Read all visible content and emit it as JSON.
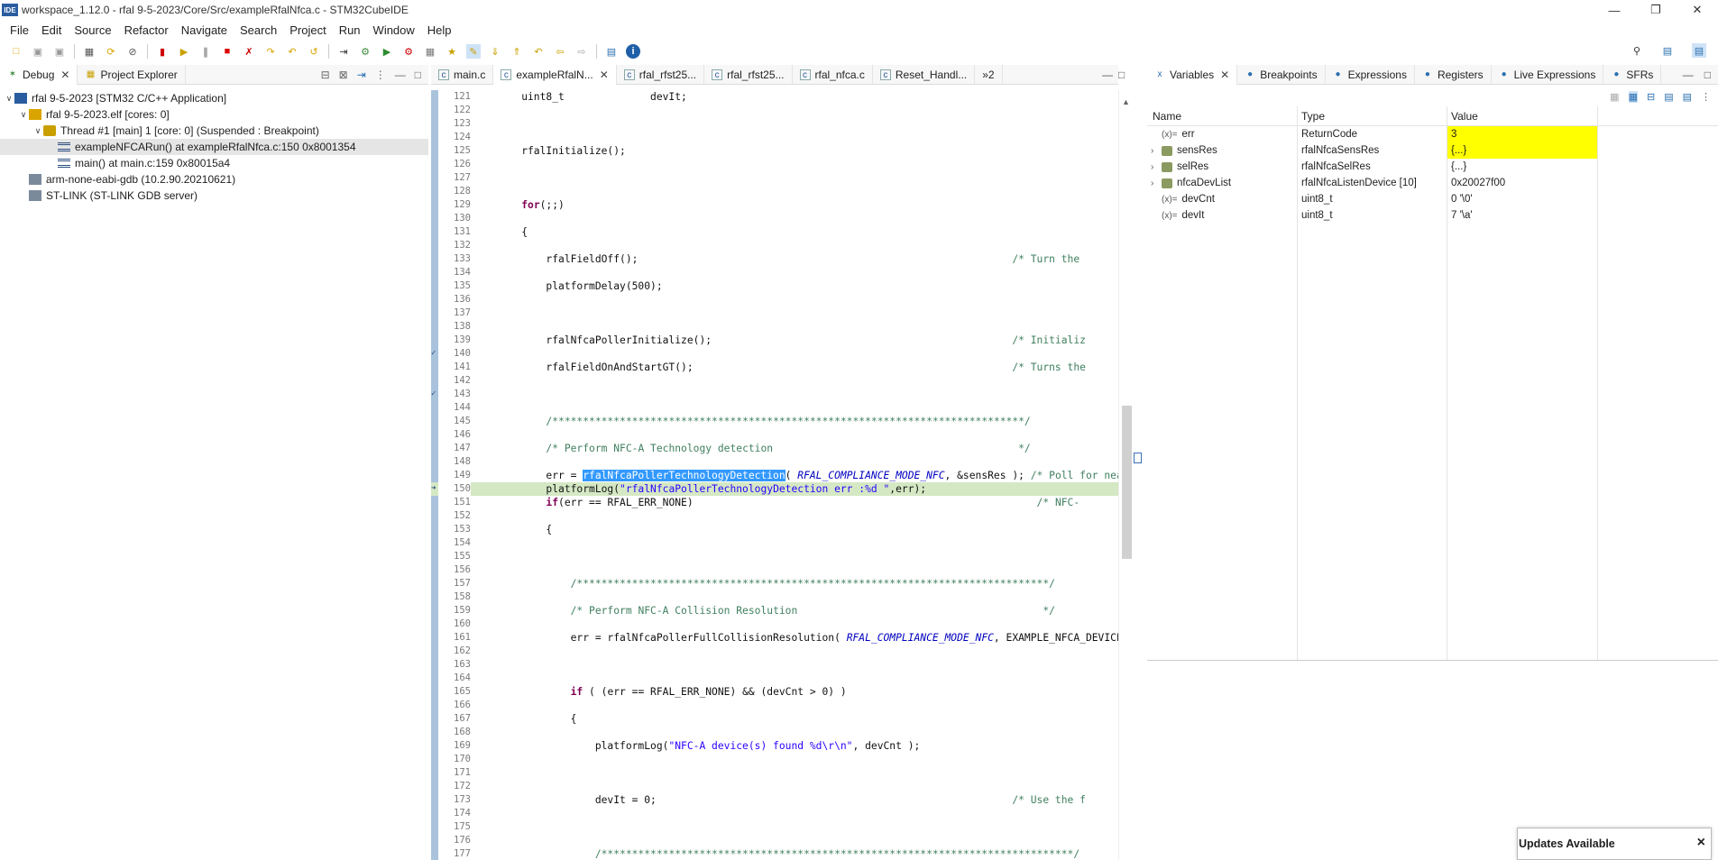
{
  "window": {
    "title": "workspace_1.12.0 - rfal 9-5-2023/Core/Src/exampleRfalNfca.c - STM32CubeIDE",
    "app_badge": "IDE"
  },
  "menu": [
    "File",
    "Edit",
    "Source",
    "Refactor",
    "Navigate",
    "Search",
    "Project",
    "Run",
    "Window",
    "Help"
  ],
  "left_tabs": {
    "debug": "Debug",
    "project_explorer": "Project Explorer"
  },
  "debug_tree": [
    {
      "label": "rfal 9-5-2023 [STM32 C/C++ Application]",
      "indent": 0,
      "arrow": "∨"
    },
    {
      "label": "rfal 9-5-2023.elf [cores: 0]",
      "indent": 1,
      "arrow": "∨"
    },
    {
      "label": "Thread #1 [main] 1 [core: 0] (Suspended : Breakpoint)",
      "indent": 2,
      "arrow": "∨"
    },
    {
      "label": "exampleNFCARun() at exampleRfalNfca.c:150 0x8001354",
      "indent": 3,
      "arrow": "",
      "selected": true
    },
    {
      "label": "main() at main.c:159 0x80015a4",
      "indent": 3,
      "arrow": ""
    },
    {
      "label": "arm-none-eabi-gdb (10.2.90.20210621)",
      "indent": 1,
      "arrow": ""
    },
    {
      "label": "ST-LINK (ST-LINK GDB server)",
      "indent": 1,
      "arrow": ""
    }
  ],
  "editor_tabs": [
    "main.c",
    "exampleRfalN...",
    "rfal_rfst25...",
    "rfal_rfst25...",
    "rfal_nfca.c",
    "Reset_Handl...",
    "»2"
  ],
  "code_lines": [
    {
      "n": "121",
      "html": "    uint8_t              devIt;"
    },
    {
      "n": "122",
      "html": ""
    },
    {
      "n": "123",
      "html": ""
    },
    {
      "n": "124",
      "html": ""
    },
    {
      "n": "125",
      "html": "    rfalInitialize();"
    },
    {
      "n": "126",
      "html": ""
    },
    {
      "n": "127",
      "html": ""
    },
    {
      "n": "128",
      "html": ""
    },
    {
      "n": "129",
      "html": "    <b class=kw>for</b>(;;)"
    },
    {
      "n": "130",
      "html": ""
    },
    {
      "n": "131",
      "html": "    {"
    },
    {
      "n": "132",
      "html": ""
    },
    {
      "n": "133",
      "html": "        rfalFieldOff();                                                             <span class=cmt>/* Turn the</span>"
    },
    {
      "n": "134",
      "html": ""
    },
    {
      "n": "135",
      "html": "        platformDelay(500);"
    },
    {
      "n": "136",
      "html": ""
    },
    {
      "n": "137",
      "html": ""
    },
    {
      "n": "138",
      "html": ""
    },
    {
      "n": "139",
      "html": "        rfalNfcaPollerInitialize();                                                 <span class=cmt>/* Initializ</span>"
    },
    {
      "n": "140",
      "html": ""
    },
    {
      "n": "141",
      "html": "        rfalFieldOnAndStartGT();                                                    <span class=cmt>/* Turns the</span>"
    },
    {
      "n": "142",
      "html": ""
    },
    {
      "n": "143",
      "html": ""
    },
    {
      "n": "144",
      "html": ""
    },
    {
      "n": "145",
      "html": "        <span class=cmt>/*****************************************************************************/</span>"
    },
    {
      "n": "146",
      "html": ""
    },
    {
      "n": "147",
      "html": "        <span class=cmt>/* Perform NFC-A Technology detection                                        */</span>"
    },
    {
      "n": "148",
      "html": ""
    },
    {
      "n": "149",
      "html": "        err = <span class=selword>rfalNfcaPollerTechnologyDetection</span>( <span class=mac>RFAL_COMPLIANCE_MODE_NFC</span>, &amp;sensRes ); <span class=cmt>/* Poll for nea</span>"
    },
    {
      "n": "150",
      "html": "        platformLog(<span class=str>\"rfalNfcaPollerTechnologyDetection err :%d \"</span>,err);",
      "hl": true
    },
    {
      "n": "151",
      "html": "        <b class=kw>if</b>(err == RFAL_ERR_NONE)                                                        <span class=cmt>/* NFC-</span>"
    },
    {
      "n": "152",
      "html": ""
    },
    {
      "n": "153",
      "html": "        {"
    },
    {
      "n": "154",
      "html": ""
    },
    {
      "n": "155",
      "html": ""
    },
    {
      "n": "156",
      "html": ""
    },
    {
      "n": "157",
      "html": "            <span class=cmt>/*****************************************************************************/</span>"
    },
    {
      "n": "158",
      "html": ""
    },
    {
      "n": "159",
      "html": "            <span class=cmt>/* Perform NFC-A Collision Resolution                                        */</span>"
    },
    {
      "n": "160",
      "html": ""
    },
    {
      "n": "161",
      "html": "            err = rfalNfcaPollerFullCollisionResolution( <span class=mac>RFAL_COMPLIANCE_MODE_NFC</span>, EXAMPLE_NFCA_DEVICE"
    },
    {
      "n": "162",
      "html": ""
    },
    {
      "n": "163",
      "html": ""
    },
    {
      "n": "164",
      "html": ""
    },
    {
      "n": "165",
      "html": "            <b class=kw>if</b> ( (err == RFAL_ERR_NONE) &amp;&amp; (devCnt &gt; 0) )"
    },
    {
      "n": "166",
      "html": ""
    },
    {
      "n": "167",
      "html": "            {"
    },
    {
      "n": "168",
      "html": ""
    },
    {
      "n": "169",
      "html": "                platformLog(<span class=str>\"NFC-A device(s) found %d\\r\\n\"</span>, devCnt );"
    },
    {
      "n": "170",
      "html": ""
    },
    {
      "n": "171",
      "html": ""
    },
    {
      "n": "172",
      "html": ""
    },
    {
      "n": "173",
      "html": "                devIt = 0;                                                          <span class=cmt>/* Use the f</span>"
    },
    {
      "n": "174",
      "html": ""
    },
    {
      "n": "175",
      "html": ""
    },
    {
      "n": "176",
      "html": ""
    },
    {
      "n": "177",
      "html": "                <span class=cmt>/*****************************************************************************/</span>"
    }
  ],
  "right_tabs": [
    "Variables",
    "Breakpoints",
    "Expressions",
    "Registers",
    "Live Expressions",
    "SFRs"
  ],
  "var_columns": {
    "name": "Name",
    "type": "Type",
    "value": "Value"
  },
  "variables": [
    {
      "name": "err",
      "type": "ReturnCode",
      "value": "3",
      "expand": false,
      "changed": true
    },
    {
      "name": "sensRes",
      "type": "rfalNfcaSensRes",
      "value": "{...}",
      "expand": true,
      "changed": true
    },
    {
      "name": "selRes",
      "type": "rfalNfcaSelRes",
      "value": "{...}",
      "expand": true,
      "changed": false
    },
    {
      "name": "nfcaDevList",
      "type": "rfalNfcaListenDevice [10]",
      "value": "0x20027f00",
      "expand": true,
      "changed": false
    },
    {
      "name": "devCnt",
      "type": "uint8_t",
      "value": "0 '\\0'",
      "expand": false,
      "changed": false
    },
    {
      "name": "devIt",
      "type": "uint8_t",
      "value": "7 '\\a'",
      "expand": false,
      "changed": false
    }
  ],
  "popup": {
    "title": "Updates Available",
    "close": "×"
  }
}
